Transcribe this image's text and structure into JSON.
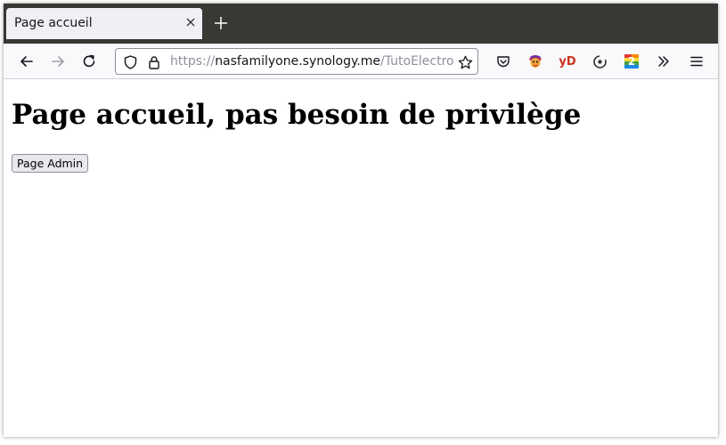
{
  "window": {
    "tab": {
      "title": "Page accueil",
      "close_icon": "close-icon"
    },
    "new_tab_icon": "plus-icon"
  },
  "toolbar": {
    "back_icon": "arrow-left-icon",
    "forward_icon": "arrow-right-icon",
    "reload_icon": "reload-icon",
    "url": {
      "scheme": "https://",
      "host": "nasfamilyone.synology.me",
      "path": "/TutoElectronDashboard/"
    },
    "extensions": [
      "pocket-icon",
      "ublock-origin-icon",
      "yd-icon",
      "vortex-icon",
      "two-icon"
    ],
    "yd_label": "yD",
    "two_label": "2",
    "overflow_icon": "chevron-double-right-icon",
    "menu_icon": "hamburger-menu-icon"
  },
  "page": {
    "heading": "Page accueil, pas besoin de privilège",
    "button_label": "Page Admin"
  }
}
